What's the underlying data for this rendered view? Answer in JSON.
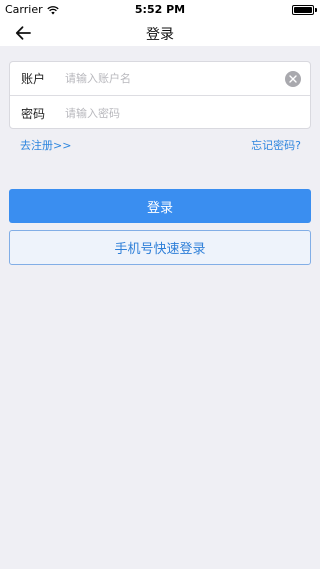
{
  "status_bar": {
    "carrier": "Carrier",
    "time": "5:52 PM",
    "wifi_icon": "wifi-icon",
    "battery_icon": "battery-icon"
  },
  "nav": {
    "back_icon": "arrow-left-icon",
    "title": "登录"
  },
  "form": {
    "account": {
      "label": "账户",
      "placeholder": "请输入账户名",
      "value": ""
    },
    "password": {
      "label": "密码",
      "placeholder": "请输入密码",
      "value": ""
    },
    "clear_icon": "clear-icon"
  },
  "links": {
    "register": "去注册>>",
    "forgot": "忘记密码?"
  },
  "buttons": {
    "login": "登录",
    "quick_login": "手机号快速登录"
  },
  "colors": {
    "primary": "#3a8ef0",
    "link": "#2e86de",
    "background": "#efeff4"
  }
}
